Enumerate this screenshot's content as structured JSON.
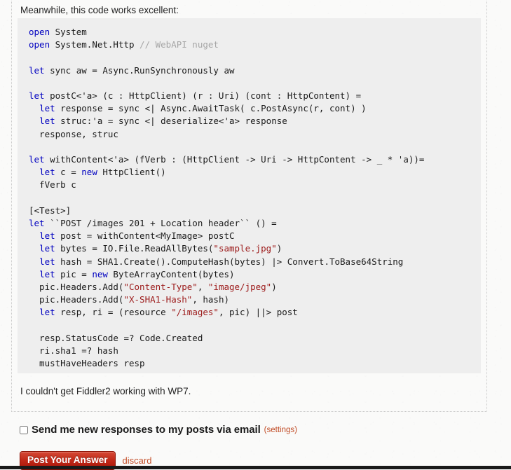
{
  "page": {
    "intro_paragraph": "Meanwhile, this code works excellent:",
    "closing_paragraph": "I couldn't get Fiddler2 working with WP7."
  },
  "code_block": {
    "language": "fsharp",
    "lines": [
      [
        [
          "open",
          "kw"
        ],
        [
          " System",
          "pln"
        ]
      ],
      [
        [
          "open",
          "kw"
        ],
        [
          " System.Net.Http ",
          "pln"
        ],
        [
          "// WebAPI nuget",
          "cmt"
        ]
      ],
      [],
      [
        [
          "let",
          "kw"
        ],
        [
          " sync aw = Async.RunSynchronously aw",
          "pln"
        ]
      ],
      [],
      [
        [
          "let",
          "kw"
        ],
        [
          " postC<'a> (c : HttpClient) (r : Uri) (cont : HttpContent) =",
          "pln"
        ]
      ],
      [
        [
          "  ",
          "pln"
        ],
        [
          "let",
          "kw"
        ],
        [
          " response = sync <| Async.AwaitTask( c.PostAsync(r, cont) )",
          "pln"
        ]
      ],
      [
        [
          "  ",
          "pln"
        ],
        [
          "let",
          "kw"
        ],
        [
          " struc:'a = sync <| deserialize<'a> response",
          "pln"
        ]
      ],
      [
        [
          "  response, struc",
          "pln"
        ]
      ],
      [],
      [
        [
          "let",
          "kw"
        ],
        [
          " withContent<'a> (fVerb : (HttpClient -> Uri -> HttpContent -> _ * 'a))=",
          "pln"
        ]
      ],
      [
        [
          "  ",
          "pln"
        ],
        [
          "let",
          "kw"
        ],
        [
          " c = ",
          "pln"
        ],
        [
          "new",
          "kw"
        ],
        [
          " HttpClient()",
          "pln"
        ]
      ],
      [
        [
          "  fVerb c",
          "pln"
        ]
      ],
      [],
      [
        [
          "[<Test>]",
          "pln"
        ]
      ],
      [
        [
          "let",
          "kw"
        ],
        [
          " ``POST /images 201 + Location header`` () =",
          "pln"
        ]
      ],
      [
        [
          "  ",
          "pln"
        ],
        [
          "let",
          "kw"
        ],
        [
          " post = withContent<MyImage> postC",
          "pln"
        ]
      ],
      [
        [
          "  ",
          "pln"
        ],
        [
          "let",
          "kw"
        ],
        [
          " bytes = IO.File.ReadAllBytes(",
          "pln"
        ],
        [
          "\"sample.jpg\"",
          "str"
        ],
        [
          ")",
          "pln"
        ]
      ],
      [
        [
          "  ",
          "pln"
        ],
        [
          "let",
          "kw"
        ],
        [
          " hash = SHA1.Create().ComputeHash(bytes) |> Convert.ToBase64String",
          "pln"
        ]
      ],
      [
        [
          "  ",
          "pln"
        ],
        [
          "let",
          "kw"
        ],
        [
          " pic = ",
          "pln"
        ],
        [
          "new",
          "kw"
        ],
        [
          " ByteArrayContent(bytes)",
          "pln"
        ]
      ],
      [
        [
          "  pic.Headers.Add(",
          "pln"
        ],
        [
          "\"Content-Type\"",
          "str"
        ],
        [
          ", ",
          "pln"
        ],
        [
          "\"image/jpeg\"",
          "str"
        ],
        [
          ")",
          "pln"
        ]
      ],
      [
        [
          "  pic.Headers.Add(",
          "pln"
        ],
        [
          "\"X-SHA1-Hash\"",
          "str"
        ],
        [
          ", hash)",
          "pln"
        ]
      ],
      [
        [
          "  ",
          "pln"
        ],
        [
          "let",
          "kw"
        ],
        [
          " resp, ri = (resource ",
          "pln"
        ],
        [
          "\"/images\"",
          "str"
        ],
        [
          ", pic) ||> post",
          "pln"
        ]
      ],
      [],
      [
        [
          "  resp.StatusCode =? Code.Created",
          "pln"
        ]
      ],
      [
        [
          "  ri.sha1 =? hash",
          "pln"
        ]
      ],
      [
        [
          "  mustHaveHeaders resp",
          "pln"
        ]
      ]
    ]
  },
  "notify": {
    "label": "Send me new responses to my posts via email",
    "settings_link": "(settings)",
    "checked": false
  },
  "actions": {
    "post_button": "Post Your Answer",
    "discard_link": "discard"
  },
  "colors": {
    "keyword": "#0000c0",
    "string": "#9c1a1a",
    "comment": "#a6a6a6",
    "plain": "#1a1a1a",
    "code_background": "#eeeeee",
    "button_red": "#c22b1a",
    "link_orange": "#c4502b"
  }
}
